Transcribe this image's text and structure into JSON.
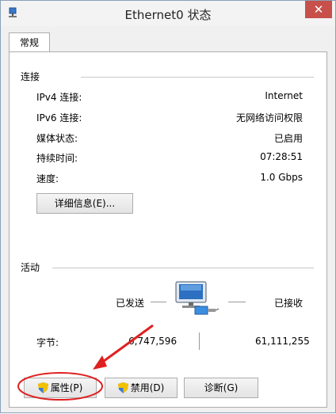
{
  "window": {
    "title": "Ethernet0 状态",
    "close_glyph": "✕"
  },
  "tabs": [
    {
      "label": "常规"
    }
  ],
  "connection": {
    "section_title": "连接",
    "rows": [
      {
        "label": "IPv4 连接:",
        "value": "Internet"
      },
      {
        "label": "IPv6 连接:",
        "value": "无网络访问权限"
      },
      {
        "label": "媒体状态:",
        "value": "已启用"
      },
      {
        "label": "持续时间:",
        "value": "07:28:51"
      },
      {
        "label": "速度:",
        "value": "1.0 Gbps"
      }
    ],
    "details_button": "详细信息(E)..."
  },
  "activity": {
    "section_title": "活动",
    "sent_label": "已发送",
    "received_label": "已接收",
    "bytes_label": "字节:",
    "bytes_sent": "6,747,596",
    "bytes_received": "61,111,255"
  },
  "buttons": {
    "properties": "属性(P)",
    "disable": "禁用(D)",
    "diagnose": "诊断(G)"
  },
  "annotation": {
    "color": "#e02020"
  }
}
